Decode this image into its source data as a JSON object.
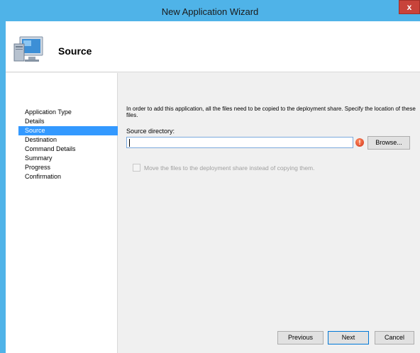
{
  "window": {
    "title": "New Application Wizard",
    "close_glyph": "x"
  },
  "header": {
    "title": "Source",
    "icon": "computer-icon"
  },
  "sidebar": {
    "items": [
      {
        "label": "Application Type",
        "active": false
      },
      {
        "label": "Details",
        "active": false
      },
      {
        "label": "Source",
        "active": true
      },
      {
        "label": "Destination",
        "active": false
      },
      {
        "label": "Command Details",
        "active": false
      },
      {
        "label": "Summary",
        "active": false
      },
      {
        "label": "Progress",
        "active": false
      },
      {
        "label": "Confirmation",
        "active": false
      }
    ]
  },
  "main": {
    "instructions": "In order to add this application, all the files need to be copied to the deployment share.  Specify the location of these files.",
    "source_label": "Source directory:",
    "source_value": "",
    "error_glyph": "!",
    "browse_label": "Browse...",
    "move_checkbox_label": "Move the files to the deployment share instead of copying them.",
    "move_checked": false
  },
  "footer": {
    "previous_label": "Previous",
    "next_label": "Next",
    "cancel_label": "Cancel"
  },
  "colors": {
    "titlebar": "#4fb3e8",
    "selection": "#3399ff",
    "close": "#c8433a",
    "error": "#d0321c"
  }
}
